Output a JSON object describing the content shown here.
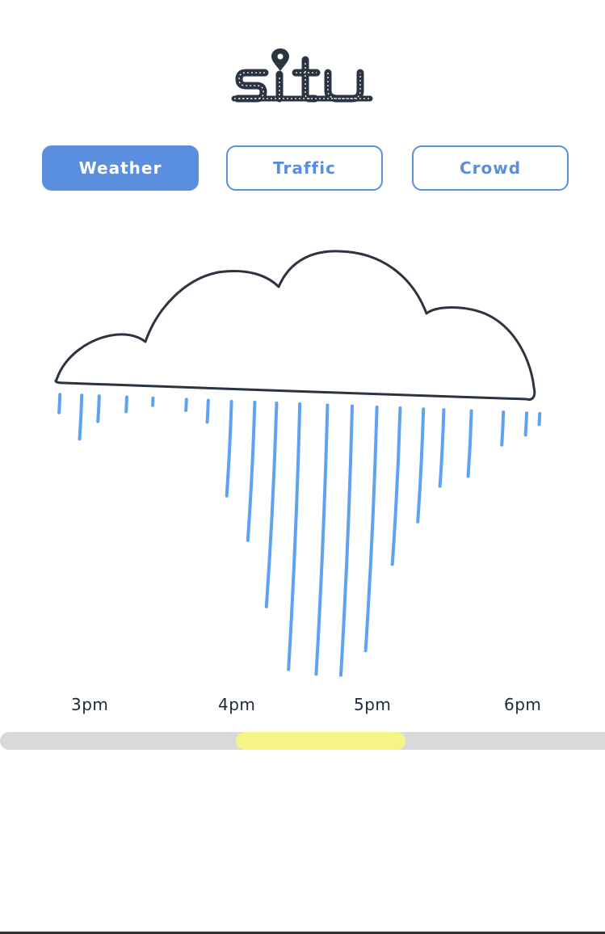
{
  "app": {
    "name": "situ",
    "logo_icon": "map-pin-icon"
  },
  "tabs": [
    {
      "label": "Weather",
      "active": true
    },
    {
      "label": "Traffic",
      "active": false
    },
    {
      "label": "Crowd",
      "active": false
    }
  ],
  "colors": {
    "accent": "#5a8fdf",
    "rain": "#5fa2f1",
    "cloud_outline": "#2b3542",
    "timeline_track": "#d9d9d9",
    "timeline_selection": "#f6f487"
  },
  "timeline": {
    "labels": [
      "3pm",
      "4pm",
      "5pm",
      "6pm"
    ],
    "selection_start": "4pm",
    "selection_end": "5:10pm"
  },
  "chart_data": {
    "type": "bar",
    "orientation": "down",
    "title": "",
    "xlabel": "",
    "ylabel": "",
    "x_ticks": [
      "3pm",
      "4pm",
      "5pm",
      "6pm"
    ],
    "x_range_hours": [
      14.8,
      18.0
    ],
    "series": [
      {
        "x_hours": [
          14.79,
          14.94,
          15.06,
          15.25,
          15.43,
          15.66,
          15.81,
          15.97,
          16.13,
          16.28,
          16.44,
          16.63,
          16.8,
          16.97,
          17.13,
          17.29,
          17.43,
          17.62,
          17.84,
          18.0,
          18.09
        ],
        "values": [
          5,
          12,
          7,
          4,
          2,
          3,
          6,
          26,
          38,
          56,
          73,
          74,
          74,
          67,
          43,
          31,
          21,
          18,
          9,
          6,
          3
        ]
      }
    ]
  }
}
